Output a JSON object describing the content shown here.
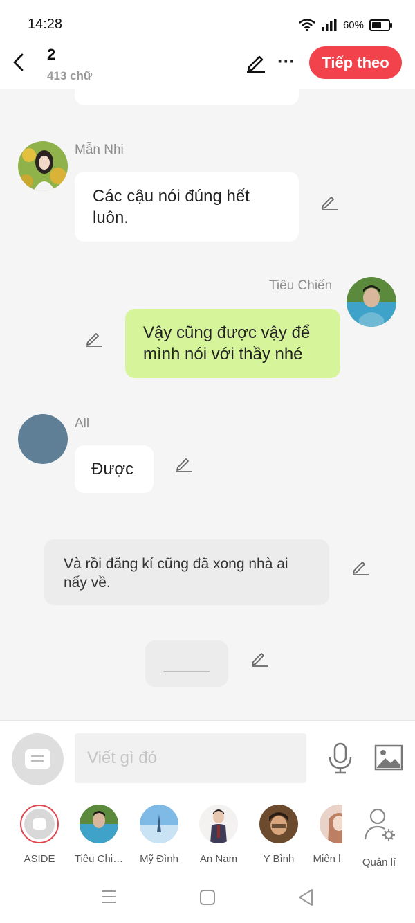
{
  "status_bar": {
    "time": "14:28",
    "battery_text": "60%",
    "battery_level": 0.6
  },
  "header": {
    "chapter": "2",
    "word_count": "413 chữ",
    "next_label": "Tiếp theo"
  },
  "messages": [
    {
      "name": "Mẫn Nhi",
      "text_line1": "Các cậu nói đúng hết",
      "text_line2": "luôn."
    },
    {
      "name": "Tiêu Chiến",
      "text_line1": "Vậy cũng được vậy để",
      "text_line2": "mình nói với thầy nhé"
    },
    {
      "name": "All",
      "text": "Được"
    }
  ],
  "narration": {
    "line1": "Và rồi đăng kí cũng đã xong nhà ai",
    "line2": "nấy về."
  },
  "separator": {
    "text": "______"
  },
  "input": {
    "placeholder": "Viết gì đó"
  },
  "characters": [
    {
      "label": "ASIDE"
    },
    {
      "label": "Tiêu Chi…"
    },
    {
      "label": "Mỹ Đình"
    },
    {
      "label": "An Nam"
    },
    {
      "label": "Y Bình"
    },
    {
      "label": "Miên l"
    },
    {
      "label": "Quản lí"
    }
  ],
  "colors": {
    "accent": "#f2434d",
    "own_bubble": "#d6f59a",
    "other_bubble": "#ffffff",
    "background": "#f5f5f5"
  },
  "icons": [
    "back-icon",
    "edit-icon",
    "more-icon",
    "pen-icon",
    "chat-icon",
    "mic-icon",
    "image-icon",
    "manage-icon",
    "menu-icon",
    "home-icon",
    "back-nav-icon"
  ]
}
